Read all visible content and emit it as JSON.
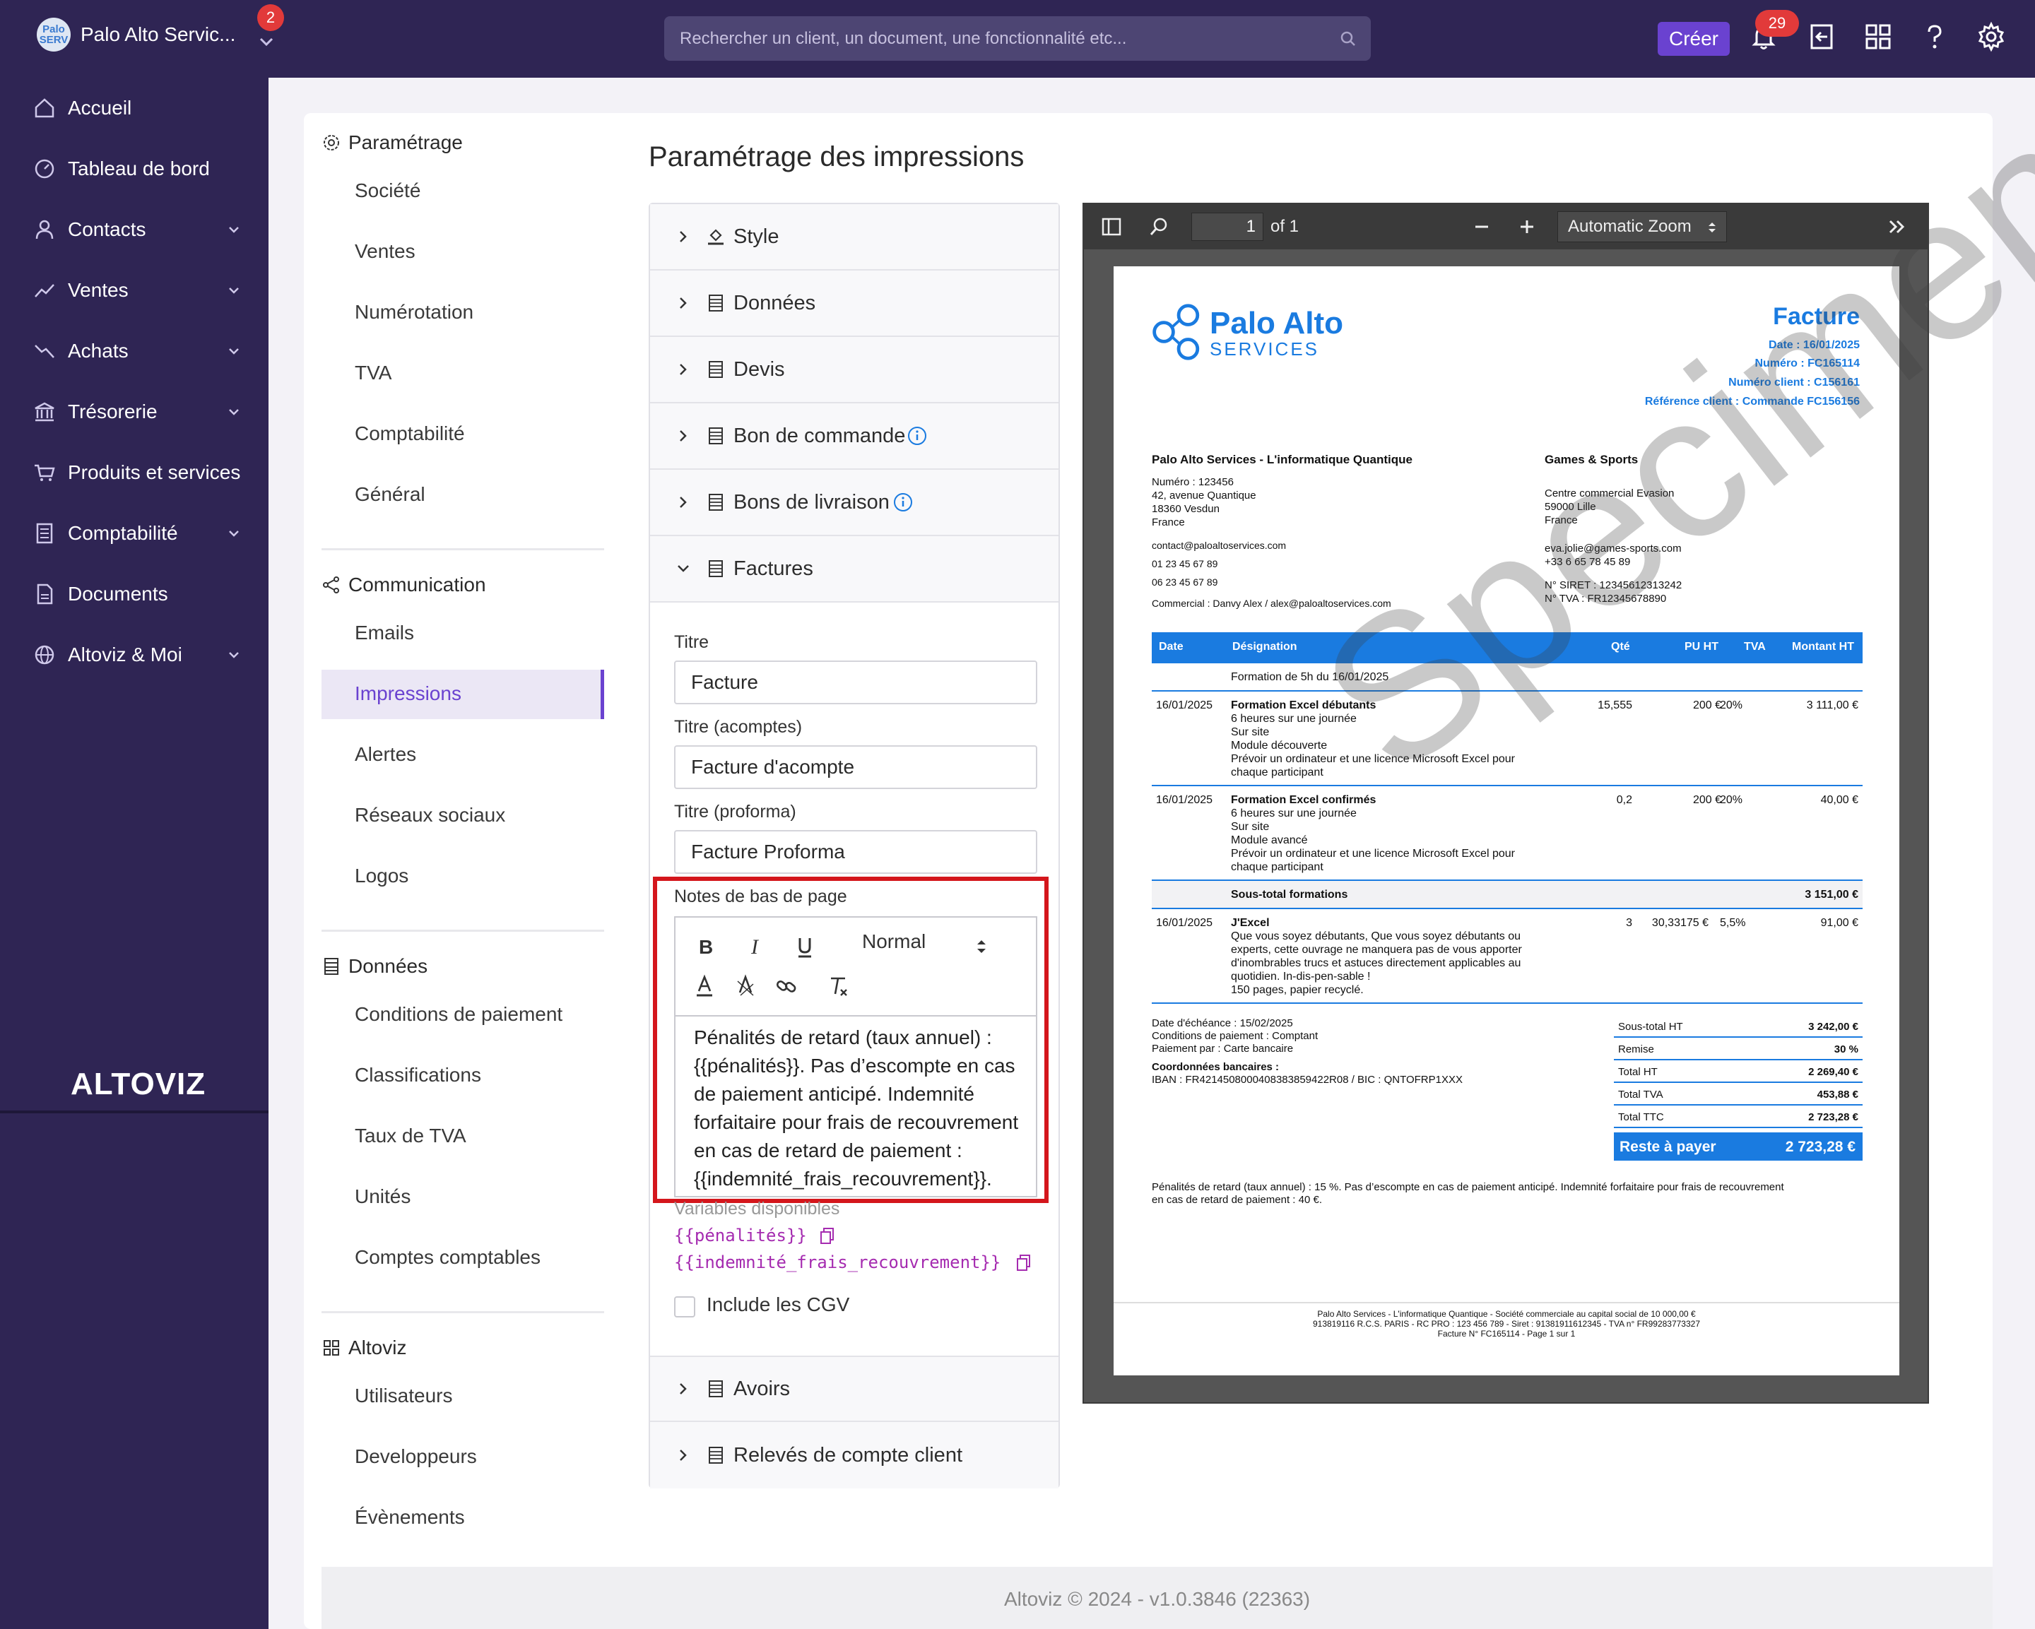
{
  "topbar": {
    "brand_logo_text": "Palo\nSERV",
    "brand_name": "Palo Alto Servic...",
    "brand_badge": "2",
    "search_placeholder": "Rechercher un client, un document, une fonctionnalité etc...",
    "create_label": "Créer",
    "notif_count": "29"
  },
  "sidebar": {
    "items": [
      {
        "label": "Accueil",
        "icon": "home-icon",
        "has_chevron": false
      },
      {
        "label": "Tableau de bord",
        "icon": "dashboard-icon",
        "has_chevron": false
      },
      {
        "label": "Contacts",
        "icon": "user-icon",
        "has_chevron": true
      },
      {
        "label": "Ventes",
        "icon": "trend-up-icon",
        "has_chevron": true
      },
      {
        "label": "Achats",
        "icon": "trend-down-icon",
        "has_chevron": true
      },
      {
        "label": "Trésorerie",
        "icon": "bank-icon",
        "has_chevron": true
      },
      {
        "label": "Produits et services",
        "icon": "cart-icon",
        "has_chevron": false
      },
      {
        "label": "Comptabilité",
        "icon": "ledger-icon",
        "has_chevron": true
      },
      {
        "label": "Documents",
        "icon": "document-icon",
        "has_chevron": false
      },
      {
        "label": "Altoviz & Moi",
        "icon": "globe-icon",
        "has_chevron": true
      }
    ],
    "logo_text": "ALTOVIZ"
  },
  "settings_nav": {
    "sections": [
      {
        "title": "Paramétrage",
        "items": [
          "Société",
          "Ventes",
          "Numérotation",
          "TVA",
          "Comptabilité",
          "Général"
        ]
      },
      {
        "title": "Communication",
        "items": [
          "Emails",
          "Impressions",
          "Alertes",
          "Réseaux sociaux",
          "Logos"
        ]
      },
      {
        "title": "Données",
        "items": [
          "Conditions de paiement",
          "Classifications",
          "Taux de TVA",
          "Unités",
          "Comptes comptables"
        ]
      },
      {
        "title": "Altoviz",
        "items": [
          "Utilisateurs",
          "Developpeurs",
          "Évènements"
        ]
      }
    ],
    "active": "Impressions"
  },
  "main": {
    "title": "Paramétrage des impressions",
    "accordion": [
      "Style",
      "Données",
      "Devis",
      "Bon de commande",
      "Bons de livraison",
      "Factures",
      "Avoirs",
      "Relevés de compte client"
    ],
    "factures": {
      "titre_label": "Titre",
      "titre_value": "Facture",
      "titre_acomptes_label": "Titre (acomptes)",
      "titre_acomptes_value": "Facture d'acompte",
      "titre_proforma_label": "Titre (proforma)",
      "titre_proforma_value": "Facture Proforma",
      "notes_label": "Notes de bas de page",
      "format_select": "Normal",
      "notes_text": "Pénalités de retard (taux annuel) : {{pénalités}}. Pas d’escompte en cas de paiement anticipé. Indemnité forfaitaire pour frais de recouvrement en cas de retard de paiement : {{indemnité_frais_recouvrement}}.",
      "vars_title": "Variables disponibles",
      "var1": "{{pénalités}}",
      "var2": "{{indemnité_frais_recouvrement}}",
      "cgv_label": "Include les CGV"
    }
  },
  "viewer": {
    "page_current": "1",
    "page_total": "of 1",
    "zoom": "Automatic Zoom"
  },
  "invoice": {
    "logo_main": "Palo Alto",
    "logo_sub": "SERVICES",
    "title": "Facture",
    "date": "Date : 16/01/2025",
    "numero": "Numéro : FC165114",
    "numero_client": "Numéro client : C156161",
    "ref_client": "Référence client : Commande FC156156",
    "seller_name": "Palo Alto Services - L'informatique Quantique",
    "seller_lines": [
      "Numéro : 123456",
      "42, avenue Quantique",
      "18360 Vesdun",
      "France"
    ],
    "seller_email": "contact@paloaltoservices.com",
    "seller_phone1": "01 23 45 67 89",
    "seller_phone2": "06 23 45 67 89",
    "seller_commercial": "Commercial : Danvy Alex / alex@paloaltoservices.com",
    "buyer_name": "Games & Sports",
    "buyer_lines": [
      "Centre commercial Evasion",
      "59000 Lille",
      "France"
    ],
    "buyer_email": "eva.jolie@games-sports.com",
    "buyer_phone": "+33 6 65 78 45 89",
    "buyer_siret": "N° SIRET : 12345612313242",
    "buyer_tva": "N° TVA : FR12345678890",
    "headers": {
      "date": "Date",
      "designation": "Désignation",
      "qte": "Qté",
      "pu": "PU HT",
      "tva": "TVA",
      "montant": "Montant HT"
    },
    "group_title": "Formation de 5h du 16/01/2025",
    "row1": {
      "date": "16/01/2025",
      "title": "Formation Excel débutants",
      "lines": [
        "6 heures sur une journée",
        "Sur site",
        "Module découverte",
        "Prévoir un ordinateur et une licence Microsoft Excel pour",
        "chaque participant"
      ],
      "qte": "15,555",
      "pu": "200 €",
      "tva": "20%",
      "montant": "3 111,00 €"
    },
    "row2": {
      "date": "16/01/2025",
      "title": "Formation Excel confirmés",
      "lines": [
        "6 heures sur une journée",
        "Sur site",
        "Module avancé",
        "Prévoir un ordinateur et une licence Microsoft Excel pour",
        "chaque participant"
      ],
      "qte": "0,2",
      "pu": "200 €",
      "tva": "20%",
      "montant": "40,00 €"
    },
    "subtotal_label": "Sous-total formations",
    "subtotal_value": "3 151,00 €",
    "row3": {
      "date": "16/01/2025",
      "title": "J'Excel",
      "lines": [
        "Que vous soyez débutants, Que vous soyez débutants ou",
        "experts, cette ouvrage ne manquera pas de vous apporter",
        "d'inombrables trucs et astuces directement applicables au",
        "quotidien. In-dis-pen-sable !",
        "150 pages, papier recyclé."
      ],
      "qte": "3",
      "pu": "30,33175 €",
      "tva": "5,5%",
      "montant": "91,00 €"
    },
    "echeance": "Date d'échéance : 15/02/2025",
    "conditions": "Conditions de paiement : Comptant",
    "paiement": "Paiement par : Carte bancaire",
    "bank_title": "Coordonnées bancaires :",
    "bank_iban": "IBAN : FR4214508000408383859422R08 / BIC : QNTOFRP1XXX",
    "totals": [
      {
        "label": "Sous-total HT",
        "value": "3 242,00 €"
      },
      {
        "label": "Remise",
        "value": "30 %"
      },
      {
        "label": "Total HT",
        "value": "2 269,40 €"
      },
      {
        "label": "Total TVA",
        "value": "453,88 €"
      },
      {
        "label": "Total TTC",
        "value": "2 723,28 €"
      }
    ],
    "reste_label": "Reste à payer",
    "reste_value": "2 723,28 €",
    "notes": [
      "Pénalités de retard (taux annuel) : 15 %. Pas d’escompte en cas de paiement anticipé. Indemnité forfaitaire pour frais de recouvrement",
      "en cas de retard de paiement : 40 €."
    ],
    "footer": [
      "Palo Alto Services - L'informatique Quantique - Société commerciale au capital social de 10 000,00 €",
      "913819116  R.C.S. PARIS - RC PRO : 123 456 789 - Siret : 9138191161234​5 - TVA n° FR99283773327",
      "Facture N° FC165114 - Page 1 sur 1"
    ],
    "watermark": "Specimen"
  },
  "footer": {
    "text": "Altoviz © 2024 - v1.0.3846 (22363)"
  },
  "colors": {
    "sidebar": "#2f2554",
    "accent": "#6a42d0",
    "invoice_blue": "#1a7be0",
    "highlight_red": "#d4161c"
  }
}
